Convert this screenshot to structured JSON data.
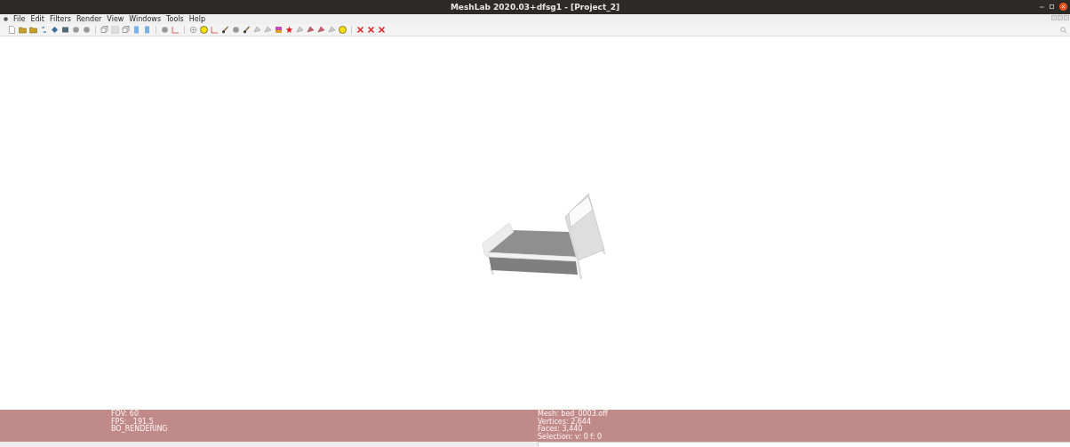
{
  "window": {
    "title": "MeshLab 2020.03+dfsg1 - [Project_2]"
  },
  "menu": [
    {
      "label": "File"
    },
    {
      "label": "Edit"
    },
    {
      "label": "Filters"
    },
    {
      "label": "Render"
    },
    {
      "label": "View"
    },
    {
      "label": "Windows"
    },
    {
      "label": "Tools"
    },
    {
      "label": "Help"
    }
  ],
  "info_panel": {
    "left": [
      "FOV: 60",
      "FPS:   191.5",
      "BO_RENDERING"
    ],
    "right": [
      "Mesh: bed_0003.off",
      "Vertices: 2,644",
      "Faces: 3,440",
      "Selection: v: 0 f: 0"
    ]
  }
}
